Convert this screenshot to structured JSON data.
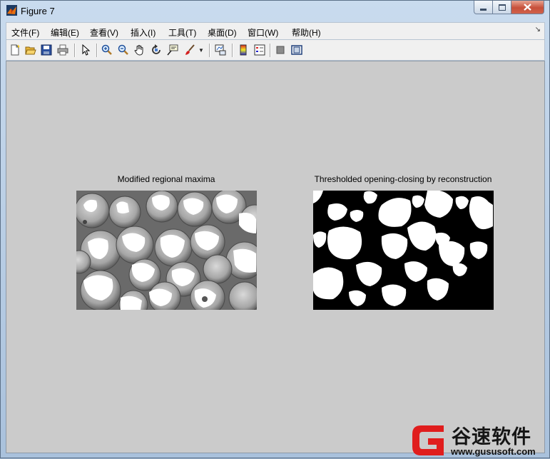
{
  "window": {
    "title": "Figure 7"
  },
  "menu": [
    "文件(F)",
    "编辑(E)",
    "查看(V)",
    "插入(I)",
    "工具(T)",
    "桌面(D)",
    "窗口(W)",
    "帮助(H)"
  ],
  "menu_overflow": "↘",
  "toolbar": [
    {
      "name": "new-figure-icon"
    },
    {
      "name": "open-file-icon"
    },
    {
      "name": "save-figure-icon"
    },
    {
      "name": "print-figure-icon"
    },
    {
      "name": "edit-plot-arrow-icon"
    },
    {
      "name": "zoom-in-icon"
    },
    {
      "name": "zoom-out-icon"
    },
    {
      "name": "pan-hand-icon"
    },
    {
      "name": "rotate-3d-icon"
    },
    {
      "name": "data-cursor-icon"
    },
    {
      "name": "brush-icon"
    },
    {
      "name": "link-plot-icon"
    },
    {
      "name": "insert-colorbar-icon"
    },
    {
      "name": "insert-legend-icon"
    },
    {
      "name": "hide-plot-tools-icon"
    },
    {
      "name": "show-plot-tools-icon"
    }
  ],
  "axes": [
    {
      "title": "Modified regional maxima",
      "style": "grayscale image with white regional maxima blobs"
    },
    {
      "title": "Thresholded opening-closing by reconstruction",
      "style": "binary black and white image"
    }
  ],
  "watermark": {
    "name": "谷速软件",
    "url": "www.gususoft.com"
  },
  "colors": {
    "canvas": "#cbcbcb",
    "titlebar": "#b9cde5",
    "watermark_red": "#e01d1d"
  }
}
